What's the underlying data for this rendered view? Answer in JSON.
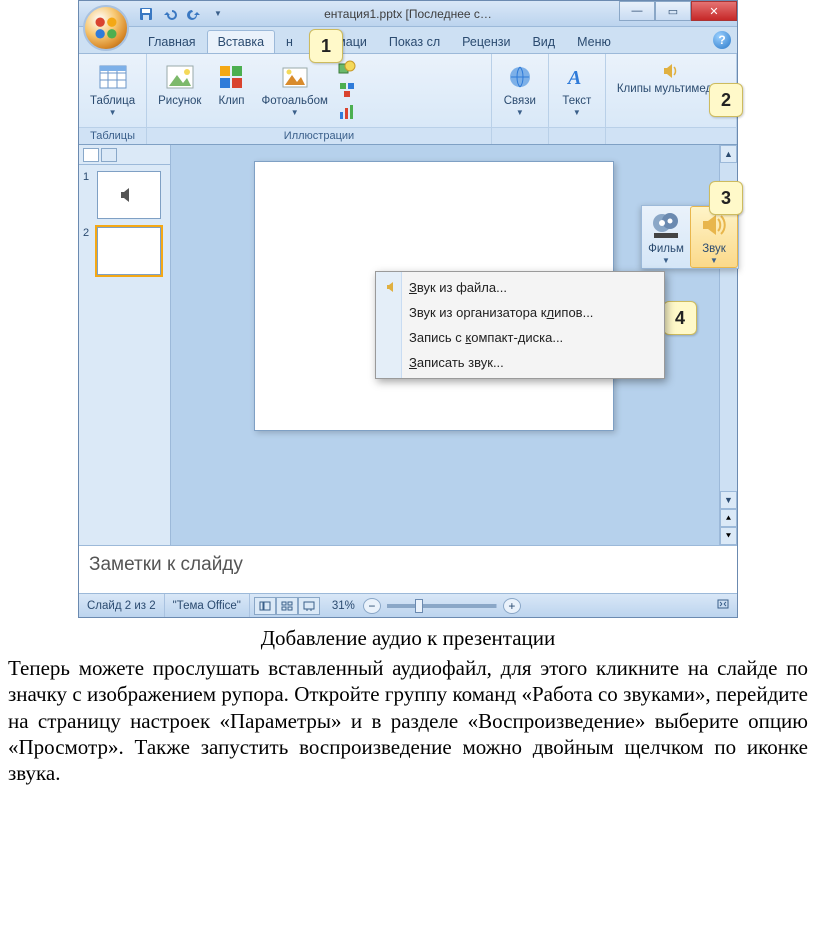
{
  "title": "ентация1.pptx [Последнее с…",
  "tabs": [
    "Главная",
    "Вставка",
    "н",
    "Анимаци",
    "Показ сл",
    "Рецензи",
    "Вид",
    "Меню"
  ],
  "active_tab_index": 1,
  "ribbon": {
    "tables": {
      "label": "Таблицы",
      "table_btn": "Таблица"
    },
    "illustrations": {
      "label": "Иллюстрации",
      "picture": "Рисунок",
      "clip": "Клип",
      "album": "Фотоальбом"
    },
    "links": {
      "label": "",
      "links_btn": "Связи"
    },
    "text": {
      "label": "",
      "text_btn": "Текст"
    },
    "media": {
      "label": "Клипы мультимедиа",
      "film": "Фильм",
      "sound": "Звук"
    }
  },
  "callouts": [
    "1",
    "2",
    "3",
    "4"
  ],
  "pane": {
    "slides": [
      {
        "num": "1"
      },
      {
        "num": "2"
      }
    ],
    "selected": 1
  },
  "dropdown": {
    "items": [
      {
        "full": "Звук из файла..."
      },
      {
        "full": "Звук из организатора клипов..."
      },
      {
        "full": "Запись с компакт-диска..."
      },
      {
        "full": "Записать звук..."
      }
    ]
  },
  "notes_placeholder": "Заметки к слайду",
  "status": {
    "slide": "Слайд 2 из 2",
    "theme": "\"Тема Office\"",
    "zoom": "31%"
  },
  "caption": "Добавление аудио к презентации",
  "bodytext": "Теперь можете прослушать вставленный аудиофайл, для этого кликните на слайде по значку с изображением рупора. Откройте группу команд «Работа со звуками», перейдите на страницу настроек «Параметры» и в разделе «Воспроизведение» выберите опцию «Просмотр». Также запустить воспроизведение можно двойным щелчком по иконке звука."
}
